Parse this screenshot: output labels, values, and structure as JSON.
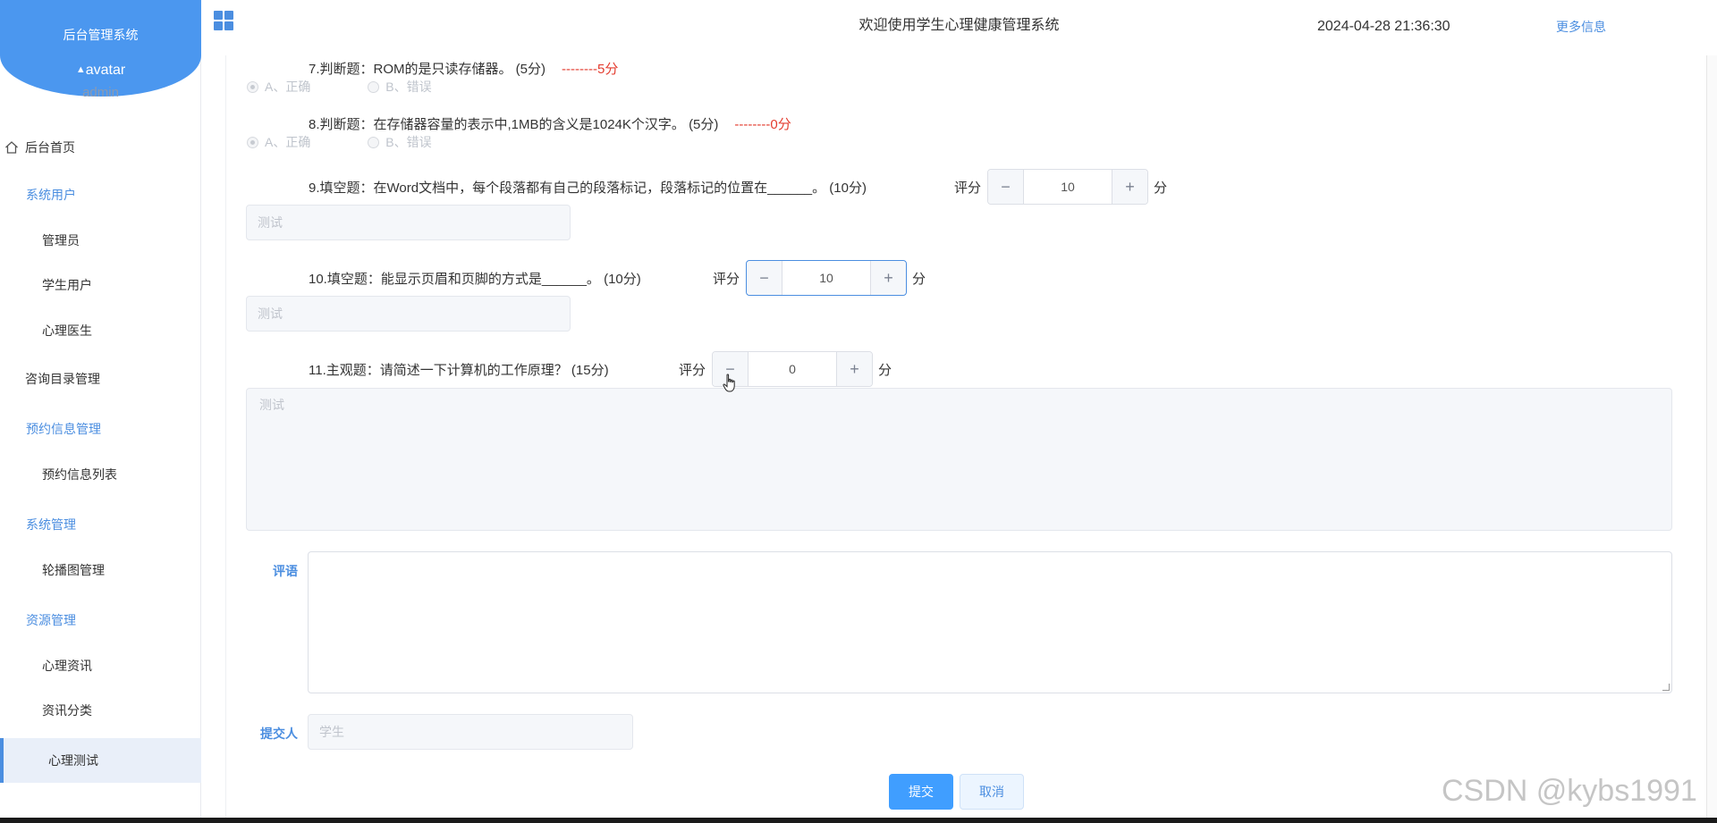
{
  "brand": {
    "title": "后台管理系统",
    "avatar_alt": "avatar",
    "username": "admin"
  },
  "menu": {
    "home": "后台首页",
    "system_users": "系统用户",
    "admin": "管理员",
    "student_user": "学生用户",
    "doctor": "心理医生",
    "consult_catalog": "咨询目录管理",
    "appointment_mgmt": "预约信息管理",
    "appointment_list": "预约信息列表",
    "system_mgmt": "系统管理",
    "carousel_mgmt": "轮播图管理",
    "resource_mgmt": "资源管理",
    "news": "心理资讯",
    "news_category": "资讯分类",
    "psych_test": "心理测试"
  },
  "header": {
    "title": "欢迎使用学生心理健康管理系统",
    "datetime": "2024-04-28 21:36:30",
    "more": "更多信息"
  },
  "questions": {
    "q7": {
      "text": "7.判断题：ROM的是只读存储器。 (5分)",
      "mark": "--------5分",
      "opt_a": "A、正确",
      "opt_b": "B、错误",
      "selected": "A"
    },
    "q8": {
      "text": "8.判断题：在存储器容量的表示中,1MB的含义是1024K个汉字。 (5分)",
      "mark": "--------0分",
      "opt_a": "A、正确",
      "opt_b": "B、错误",
      "selected": "A"
    },
    "q9": {
      "text": "9.填空题：在Word文档中，每个段落都有自己的段落标记，段落标记的位置在______。 (10分)",
      "score_label": "评分",
      "score": "10",
      "unit": "分",
      "answer": "测试"
    },
    "q10": {
      "text": "10.填空题：能显示页眉和页脚的方式是______。 (10分)",
      "score_label": "评分",
      "score": "10",
      "unit": "分",
      "answer": "测试"
    },
    "q11": {
      "text": "11.主观题：请简述一下计算机的工作原理？ (15分)",
      "score_label": "评分",
      "score": "0",
      "unit": "分",
      "answer": "测试"
    }
  },
  "form": {
    "comment_label": "评语",
    "comment_value": "",
    "submitter_label": "提交人",
    "submitter_value": "学生",
    "submit": "提交",
    "cancel": "取消"
  },
  "icons": {
    "minus": "−",
    "plus": "+"
  },
  "watermark": "CSDN @kybs1991",
  "colors": {
    "accent": "#4b8ee0",
    "brand": "#4b97ef",
    "mark_red": "#e33c2f",
    "primary_button": "#409eff"
  }
}
